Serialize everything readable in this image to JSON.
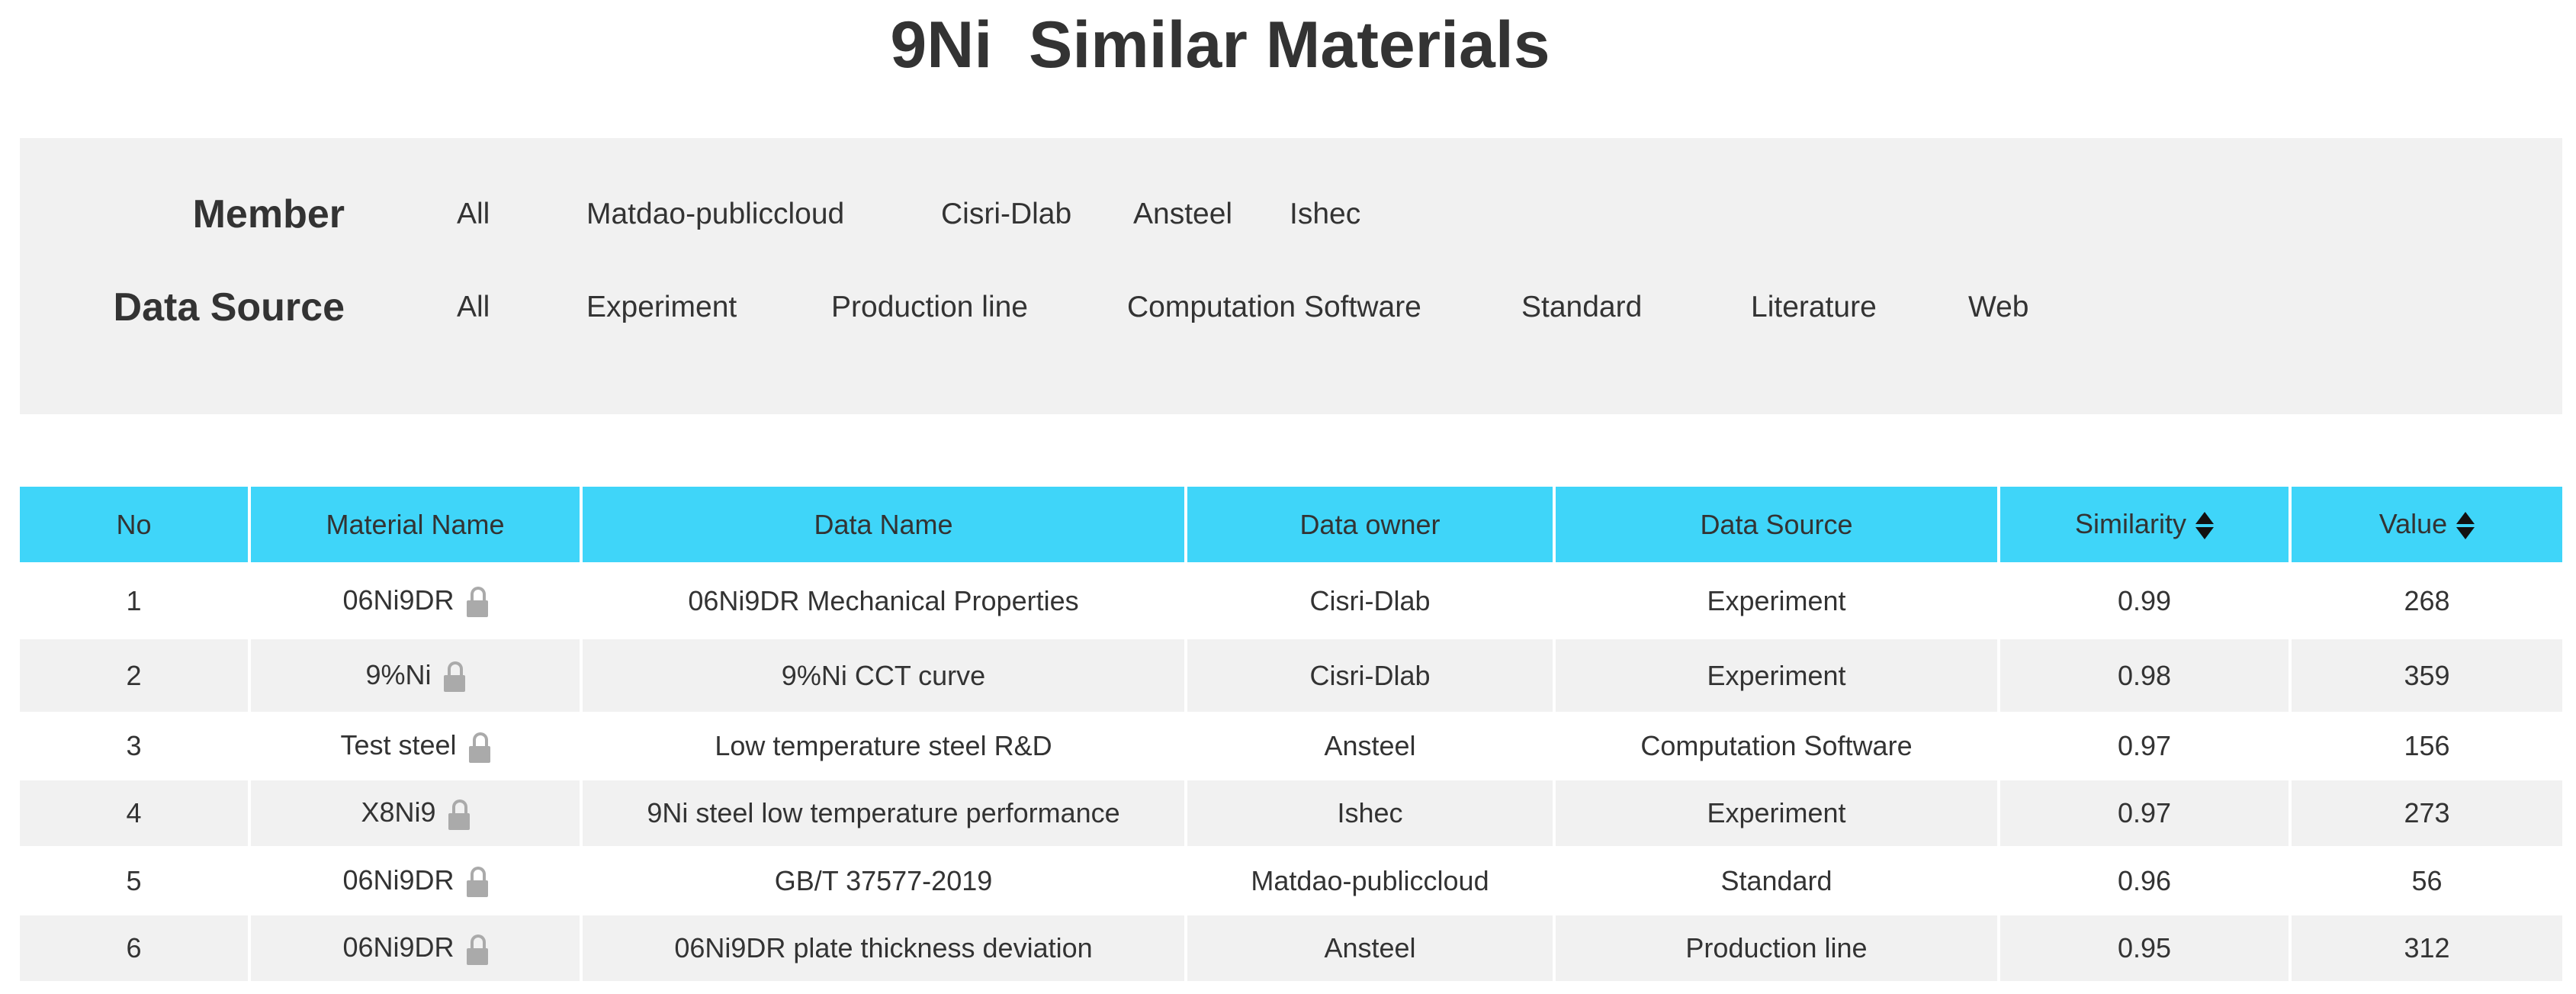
{
  "title": "9Ni  Similar Materials",
  "filters": {
    "member": {
      "label": "Member",
      "options": [
        "All",
        "Matdao-publiccloud",
        "Cisri-Dlab",
        "Ansteel",
        "Ishec"
      ]
    },
    "data_source": {
      "label": "Data Source",
      "options": [
        "All",
        "Experiment",
        "Production line",
        "Computation Software",
        "Standard",
        "Literature",
        "Web"
      ]
    }
  },
  "table": {
    "headers": [
      "No",
      "Material Name",
      "Data Name",
      "Data owner",
      "Data Source",
      "Similarity",
      "Value"
    ],
    "rows": [
      {
        "no": "1",
        "material": "06Ni9DR",
        "data_name": "06Ni9DR Mechanical Properties",
        "owner": "Cisri-Dlab",
        "source": "Experiment",
        "similarity": "0.99",
        "value": "268"
      },
      {
        "no": "2",
        "material": "9%Ni",
        "data_name": "9%Ni CCT curve",
        "owner": "Cisri-Dlab",
        "source": "Experiment",
        "similarity": "0.98",
        "value": "359"
      },
      {
        "no": "3",
        "material": "Test steel",
        "data_name": "Low temperature steel R&D",
        "owner": "Ansteel",
        "source": "Computation Software",
        "similarity": "0.97",
        "value": "156"
      },
      {
        "no": "4",
        "material": "X8Ni9",
        "data_name": "9Ni steel low temperature performance",
        "owner": "Ishec",
        "source": "Experiment",
        "similarity": "0.97",
        "value": "273"
      },
      {
        "no": "5",
        "material": "06Ni9DR",
        "data_name": "GB/T 37577-2019",
        "owner": "Matdao-publiccloud",
        "source": "Standard",
        "similarity": "0.96",
        "value": "56"
      },
      {
        "no": "6",
        "material": "06Ni9DR",
        "data_name": "06Ni9DR plate thickness deviation",
        "owner": "Ansteel",
        "source": "Production line",
        "similarity": "0.95",
        "value": "312"
      }
    ]
  },
  "colors": {
    "header_bg": "#3fd5f9",
    "panel_bg": "#f1f1f1",
    "lock": "#aaaaaa"
  }
}
